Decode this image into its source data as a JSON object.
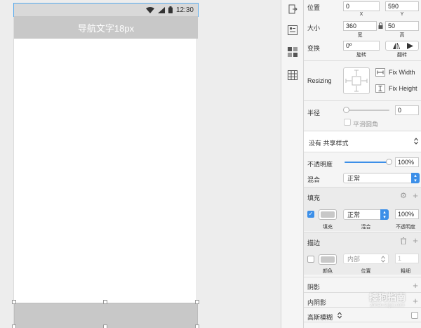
{
  "artboard": {
    "status_time": "12:30",
    "nav_title": "导航文字18px"
  },
  "inspector": {
    "position": {
      "label": "位置",
      "x": "0",
      "y": "590",
      "x_caption": "X",
      "y_caption": "Y"
    },
    "size": {
      "label": "大小",
      "w": "360",
      "h": "50",
      "w_caption": "宽",
      "h_caption": "高"
    },
    "transform": {
      "label": "变换",
      "rotate": "0º",
      "rotate_caption": "旋转",
      "flip_caption": "翻转"
    },
    "resizing": {
      "label": "Resizing",
      "fix_width": "Fix Width",
      "fix_height": "Fix Height"
    },
    "radius": {
      "label": "半径",
      "value": "0",
      "smooth_label": "平滑圆角"
    },
    "shared_style": {
      "value": "没有 共享样式"
    },
    "opacity": {
      "label": "不透明度",
      "value": "100%",
      "level": 1.0
    },
    "blend": {
      "label": "混合",
      "value": "正常"
    },
    "fill": {
      "label": "填充",
      "blend_value": "正常",
      "opacity_value": "100%",
      "caption_fill": "填充",
      "caption_blend": "混合",
      "caption_opacity": "不透明度",
      "color": "#c8c8c8"
    },
    "border": {
      "label": "描边",
      "position_value": "内部",
      "thickness_value": "1",
      "caption_color": "颜色",
      "caption_position": "位置",
      "caption_thickness": "粗细"
    },
    "shadow": {
      "label": "阴影"
    },
    "inner_shadow": {
      "label": "内阴影"
    },
    "blur": {
      "label": "高斯模糊"
    }
  },
  "watermark": {
    "text": "搜狗指南",
    "sub": "zhinan.sogou.com"
  },
  "colors": {
    "accent": "#3c8fe8",
    "bar_gray": "#c8c8c8",
    "selection": "#55aaee"
  }
}
